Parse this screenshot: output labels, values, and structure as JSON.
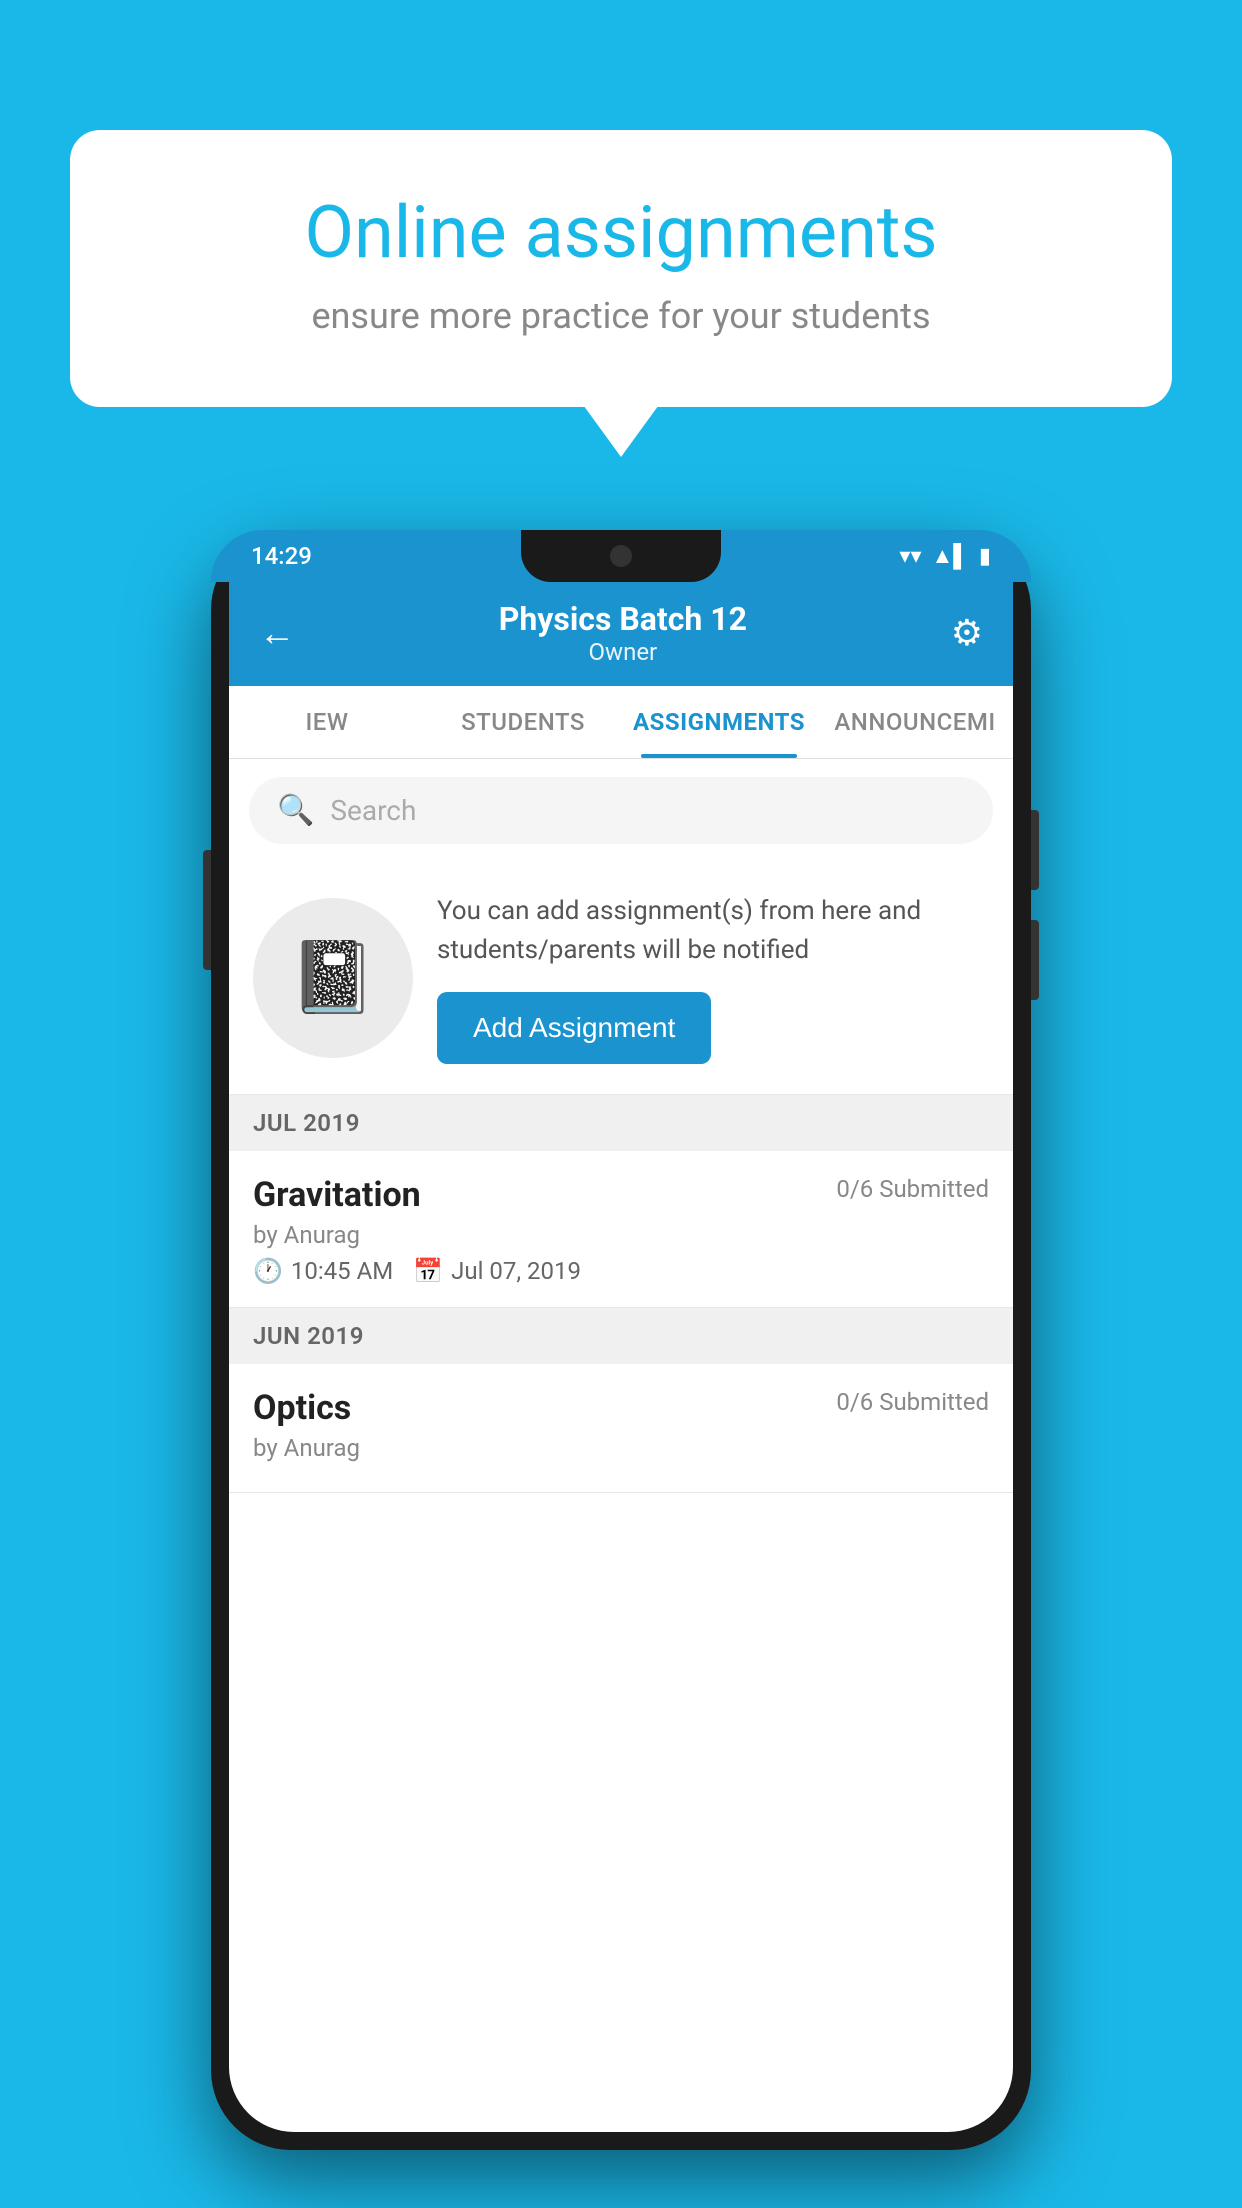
{
  "background_color": "#1ab8e8",
  "speech_bubble": {
    "title": "Online assignments",
    "subtitle": "ensure more practice for your students"
  },
  "status_bar": {
    "time": "14:29",
    "icons": [
      "▼",
      "▲",
      "▌"
    ]
  },
  "header": {
    "title": "Physics Batch 12",
    "subtitle": "Owner",
    "back_label": "←",
    "gear_label": "⚙"
  },
  "tabs": [
    {
      "label": "IEW",
      "active": false
    },
    {
      "label": "STUDENTS",
      "active": false
    },
    {
      "label": "ASSIGNMENTS",
      "active": true
    },
    {
      "label": "ANNOUNCEMI",
      "active": false
    }
  ],
  "search": {
    "placeholder": "Search"
  },
  "empty_state": {
    "description": "You can add assignment(s) from here and students/parents will be notified",
    "add_button_label": "Add Assignment"
  },
  "sections": [
    {
      "label": "JUL 2019",
      "assignments": [
        {
          "name": "Gravitation",
          "submitted": "0/6 Submitted",
          "by": "by Anurag",
          "time": "10:45 AM",
          "date": "Jul 07, 2019"
        }
      ]
    },
    {
      "label": "JUN 2019",
      "assignments": [
        {
          "name": "Optics",
          "submitted": "0/6 Submitted",
          "by": "by Anurag",
          "time": "",
          "date": ""
        }
      ]
    }
  ]
}
